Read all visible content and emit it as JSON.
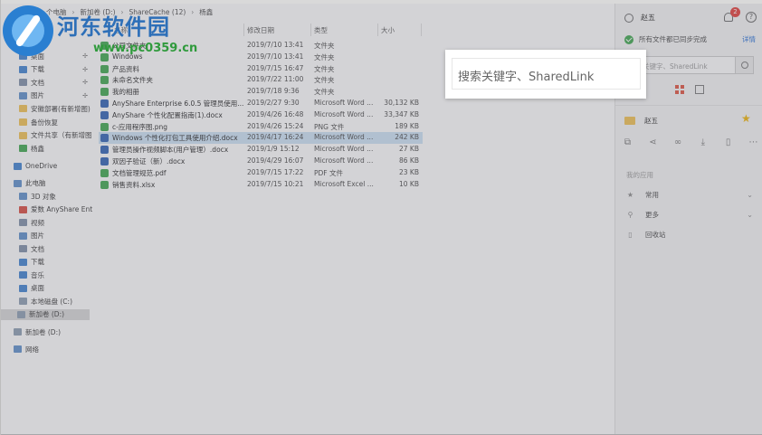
{
  "watermark": {
    "title": "河东软件园",
    "url": "www.pc0359.cn"
  },
  "breadcrumb": [
    "个电脑",
    "新加卷 (D:)",
    "ShareCache (12)",
    "杨鑫"
  ],
  "columns": {
    "name": "名称",
    "date": "修改日期",
    "type": "类型",
    "size": "大小"
  },
  "nav": {
    "quick": [
      {
        "label": "桌面",
        "pinned": true,
        "color": "#3b7fcf"
      },
      {
        "label": "下载",
        "pinned": true,
        "color": "#3b7fcf"
      },
      {
        "label": "文档",
        "pinned": true,
        "color": "#7c8da6"
      },
      {
        "label": "图片",
        "pinned": true,
        "color": "#5a8cc9"
      },
      {
        "label": "安徽部署(有新增图)",
        "pinned": false,
        "color": "#f2c14e"
      },
      {
        "label": "备份恢复",
        "pinned": false,
        "color": "#f2c14e"
      },
      {
        "label": "文件共享（有新增图",
        "pinned": false,
        "color": "#f2c14e"
      },
      {
        "label": "杨鑫",
        "pinned": false,
        "color": "#3aa64a"
      }
    ],
    "onedrive": "OneDrive",
    "thispc": "此电脑",
    "pc_items": [
      {
        "label": "3D 对象",
        "color": "#5a8cc9"
      },
      {
        "label": "爱数 AnyShare Ent",
        "color": "#d9473b"
      },
      {
        "label": "视频",
        "color": "#7c8da6"
      },
      {
        "label": "图片",
        "color": "#5a8cc9"
      },
      {
        "label": "文档",
        "color": "#7c8da6"
      },
      {
        "label": "下载",
        "color": "#3b7fcf"
      },
      {
        "label": "音乐",
        "color": "#3b7fcf"
      },
      {
        "label": "桌面",
        "color": "#3b7fcf"
      },
      {
        "label": "本地磁盘 (C:)",
        "color": "#8a9bb0"
      },
      {
        "label": "新加卷 (D:)",
        "color": "#8a9bb0"
      }
    ],
    "drive_d": "新加卷 (D:)",
    "network": "网络"
  },
  "files": [
    {
      "name": "公司文件夹",
      "date": "2019/7/10 13:41",
      "type": "文件夹",
      "size": "",
      "color": "#3aa64a"
    },
    {
      "name": "Windows",
      "date": "2019/7/10 13:41",
      "type": "文件夹",
      "size": "",
      "color": "#3aa64a"
    },
    {
      "name": "产品资料",
      "date": "2019/7/15 16:47",
      "type": "文件夹",
      "size": "",
      "color": "#3aa64a"
    },
    {
      "name": "未命名文件夹",
      "date": "2019/7/22 11:00",
      "type": "文件夹",
      "size": "",
      "color": "#3aa64a"
    },
    {
      "name": "我的相册",
      "date": "2019/7/18 9:36",
      "type": "文件夹",
      "size": "",
      "color": "#3aa64a"
    },
    {
      "name": "AnyShare Enterprise 6.0.5 管理员使用...",
      "date": "2019/2/27 9:30",
      "type": "Microsoft Word ...",
      "size": "30,132 KB",
      "color": "#2b5fb4"
    },
    {
      "name": "AnyShare 个性化配置指南(1).docx",
      "date": "2019/4/26 16:48",
      "type": "Microsoft Word ...",
      "size": "33,347 KB",
      "color": "#2b5fb4"
    },
    {
      "name": "c-应用程序图.png",
      "date": "2019/4/26 15:24",
      "type": "PNG 文件",
      "size": "189 KB",
      "color": "#3aa64a"
    },
    {
      "name": "Windows 个性化打包工具使用介绍.docx",
      "date": "2019/4/17 16:24",
      "type": "Microsoft Word ...",
      "size": "242 KB",
      "color": "#2b5fb4",
      "selected": true
    },
    {
      "name": "管理员操作视频脚本(用户管理）.docx",
      "date": "2019/1/9 15:12",
      "type": "Microsoft Word ...",
      "size": "27 KB",
      "color": "#2b5fb4"
    },
    {
      "name": "双因子验证（新）.docx",
      "date": "2019/4/29 16:07",
      "type": "Microsoft Word ...",
      "size": "86 KB",
      "color": "#2b5fb4"
    },
    {
      "name": "文档管理规范.pdf",
      "date": "2019/7/15 17:22",
      "type": "PDF 文件",
      "size": "23 KB",
      "color": "#3aa64a"
    },
    {
      "name": "销售资料.xlsx",
      "date": "2019/7/15 10:21",
      "type": "Microsoft Excel ...",
      "size": "10 KB",
      "color": "#3aa64a"
    }
  ],
  "panel": {
    "user": "赵五",
    "notif_count": "2",
    "help": "?",
    "sync_status": "所有文件都已同步完成",
    "detail": "详情",
    "search_placeholder": "搜索关键字、SharedLink",
    "folder_name": "赵五",
    "recent_label": "我的应用",
    "items": [
      {
        "label": "常用",
        "icon": "★",
        "chev": true
      },
      {
        "label": "更多",
        "icon": "⚲",
        "chev": true
      },
      {
        "label": "回收站",
        "icon": "▯",
        "chev": false
      }
    ]
  },
  "dialog": {
    "search_text": "搜索关键字、SharedLink"
  }
}
